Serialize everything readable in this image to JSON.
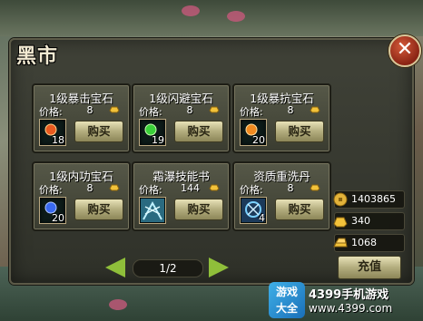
{
  "window": {
    "title": "黑市",
    "close_label": "✕"
  },
  "items": [
    {
      "name": "1级暴击宝石",
      "price_label": "价格:",
      "price": "8",
      "quantity": "18",
      "buy_label": "购买",
      "icon": "red-gem-icon",
      "color": "#e85a20"
    },
    {
      "name": "1级闪避宝石",
      "price_label": "价格:",
      "price": "8",
      "quantity": "19",
      "buy_label": "购买",
      "icon": "green-gem-icon",
      "color": "#3ad03a"
    },
    {
      "name": "1级暴抗宝石",
      "price_label": "价格:",
      "price": "8",
      "quantity": "20",
      "buy_label": "购买",
      "icon": "orange-gem-icon",
      "color": "#f08a20"
    },
    {
      "name": "1级内功宝石",
      "price_label": "价格:",
      "price": "8",
      "quantity": "20",
      "buy_label": "购买",
      "icon": "blue-gem-icon",
      "color": "#3a6af0"
    },
    {
      "name": "霜瀑技能书",
      "price_label": "价格:",
      "price": "144",
      "quantity": "",
      "buy_label": "购买",
      "icon": "frost-skill-book-icon",
      "color": "#7ad0e8"
    },
    {
      "name": "资质重洗丹",
      "price_label": "价格:",
      "price": "8",
      "quantity": "4",
      "buy_label": "购买",
      "icon": "aptitude-reset-pill-icon",
      "color": "#4aa8e8"
    }
  ],
  "pager": {
    "indicator": "1/2"
  },
  "currencies": [
    {
      "icon": "copper-coin-icon",
      "value": "1403865"
    },
    {
      "icon": "gold-ingot-icon",
      "value": "340"
    },
    {
      "icon": "gold-bar-icon",
      "value": "1068"
    }
  ],
  "recharge_label": "充值",
  "brand": {
    "badge": "游戏\n大全",
    "line1": "4399手机游戏",
    "line2": "www.4399.com"
  }
}
